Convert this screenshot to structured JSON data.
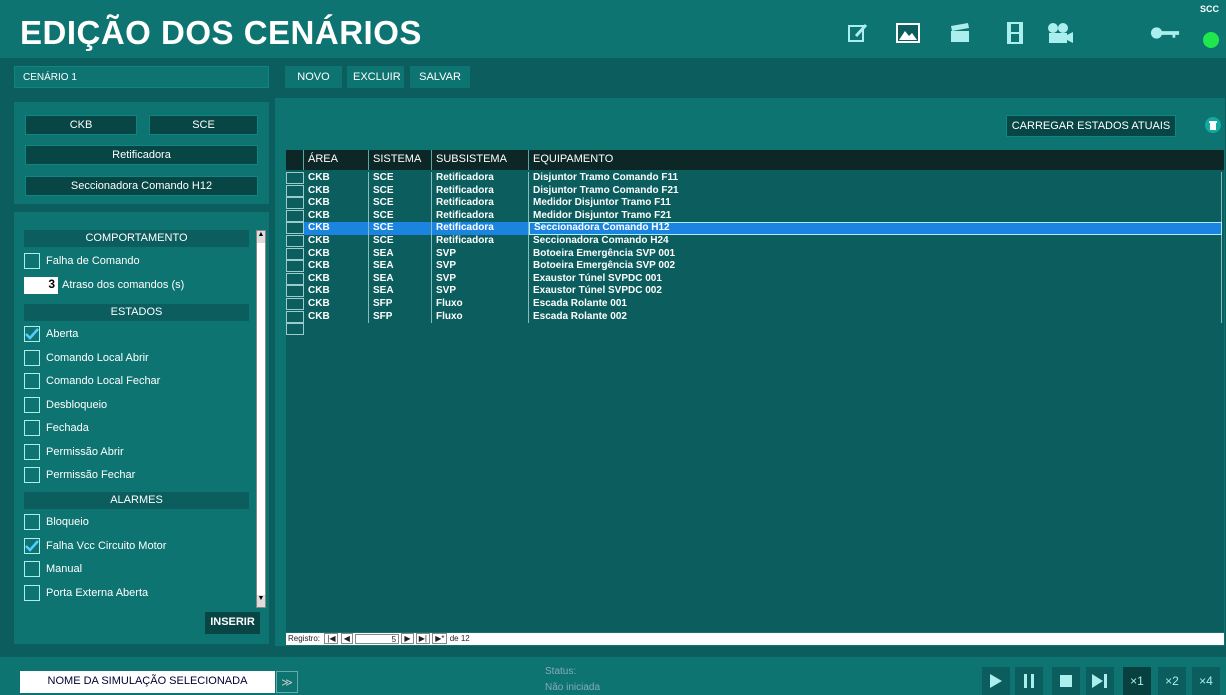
{
  "header": {
    "title": "EDIÇÃO DOS CENÁRIOS",
    "scc_label": "SCC"
  },
  "scenario": {
    "name": "CENÁRIO 1"
  },
  "toolbar": {
    "new_label": "NOVO",
    "delete_label": "EXCLUIR",
    "save_label": "SALVAR"
  },
  "filters": {
    "area": "CKB",
    "system": "SCE",
    "subsystem": "Retificadora",
    "equipment": "Seccionadora Comando H12"
  },
  "behavior": {
    "heading": "COMPORTAMENTO",
    "command_failure": "Falha de Comando",
    "delay_value": "3",
    "delay_label": "Atraso dos comandos (s)"
  },
  "states": {
    "heading": "ESTADOS",
    "items": [
      {
        "label": "Aberta",
        "checked": true
      },
      {
        "label": "Comando Local Abrir",
        "checked": false
      },
      {
        "label": "Comando Local Fechar",
        "checked": false
      },
      {
        "label": "Desbloqueio",
        "checked": false
      },
      {
        "label": "Fechada",
        "checked": false
      },
      {
        "label": "Permissão Abrir",
        "checked": false
      },
      {
        "label": "Permissão Fechar",
        "checked": false
      }
    ]
  },
  "alarms": {
    "heading": "ALARMES",
    "items": [
      {
        "label": "Bloqueio",
        "checked": false
      },
      {
        "label": "Falha Vcc Circuito Motor",
        "checked": true
      },
      {
        "label": "Manual",
        "checked": false
      },
      {
        "label": "Porta Externa Aberta",
        "checked": false
      }
    ]
  },
  "insert_label": "INSERIR",
  "load_states_label": "CARREGAR ESTADOS ATUAIS",
  "grid": {
    "columns": [
      "ÁREA",
      "SISTEMA",
      "SUBSISTEMA",
      "EQUIPAMENTO"
    ],
    "selected_index": 4,
    "rows": [
      [
        "CKB",
        "SCE",
        "Retificadora",
        "Disjuntor Tramo Comando F11"
      ],
      [
        "CKB",
        "SCE",
        "Retificadora",
        "Disjuntor Tramo Comando F21"
      ],
      [
        "CKB",
        "SCE",
        "Retificadora",
        "Medidor Disjuntor Tramo F11"
      ],
      [
        "CKB",
        "SCE",
        "Retificadora",
        "Medidor Disjuntor Tramo F21"
      ],
      [
        "CKB",
        "SCE",
        "Retificadora",
        "Seccionadora Comando H12"
      ],
      [
        "CKB",
        "SCE",
        "Retificadora",
        "Seccionadora Comando H24"
      ],
      [
        "CKB",
        "SEA",
        "SVP",
        "Botoeira Emergência SVP 001"
      ],
      [
        "CKB",
        "SEA",
        "SVP",
        "Botoeira Emergência SVP 002"
      ],
      [
        "CKB",
        "SEA",
        "SVP",
        "Exaustor Túnel SVPDC 001"
      ],
      [
        "CKB",
        "SEA",
        "SVP",
        "Exaustor Túnel SVPDC 002"
      ],
      [
        "CKB",
        "SFP",
        "Fluxo",
        "Escada Rolante 001"
      ],
      [
        "CKB",
        "SFP",
        "Fluxo",
        "Escada Rolante 002"
      ]
    ]
  },
  "navigator": {
    "label": "Registro:",
    "current": "5",
    "total_text": "de 12"
  },
  "footer": {
    "sim_name": "NOME DA SIMULAÇÃO SELECIONADA",
    "status_label": "Status:",
    "status_value": "Não iniciada",
    "speeds": [
      "×1",
      "×2",
      "×4"
    ]
  }
}
